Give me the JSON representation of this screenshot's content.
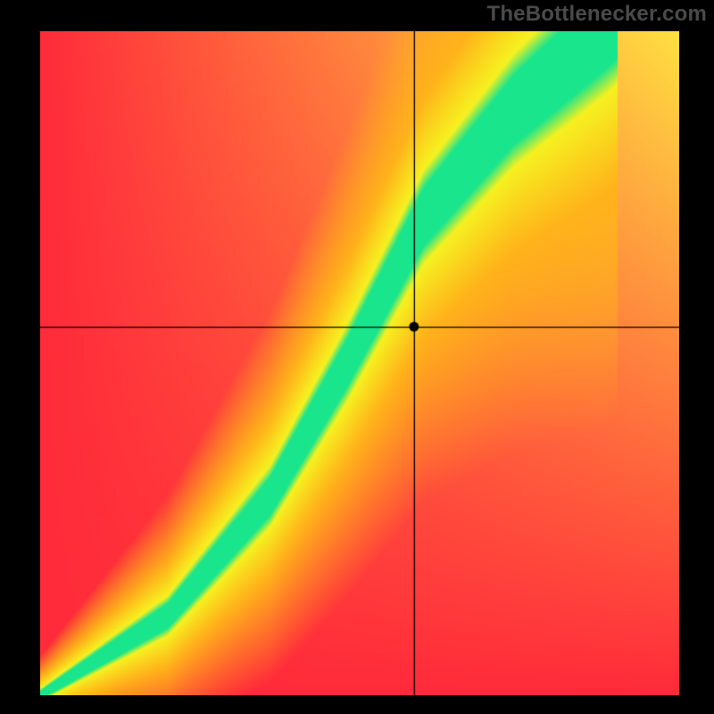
{
  "watermark": "TheBottlenecker.com",
  "chart_data": {
    "type": "heatmap",
    "title": "",
    "xlabel": "",
    "ylabel": "",
    "xlim": [
      0,
      1
    ],
    "ylim": [
      0,
      1
    ],
    "crosshair": {
      "x": 0.585,
      "y": 0.555
    },
    "marker": {
      "x": 0.585,
      "y": 0.555
    },
    "curve_control_points": [
      {
        "x": 0.0,
        "y": 0.0
      },
      {
        "x": 0.2,
        "y": 0.12
      },
      {
        "x": 0.36,
        "y": 0.3
      },
      {
        "x": 0.48,
        "y": 0.5
      },
      {
        "x": 0.6,
        "y": 0.72
      },
      {
        "x": 0.74,
        "y": 0.88
      },
      {
        "x": 0.88,
        "y": 1.0
      }
    ],
    "band_width_norm": {
      "bottom": 0.01,
      "top": 0.1
    },
    "colors": {
      "optimal": "#19e58d",
      "near": "#f6f120",
      "mid": "#ffb31a",
      "far": "#ff2a3a",
      "bottom_left": "#ff2a3a",
      "bottom_right": "#ff2a3a",
      "top_left": "#ff2a3a",
      "top_right": "#ffe040"
    }
  }
}
